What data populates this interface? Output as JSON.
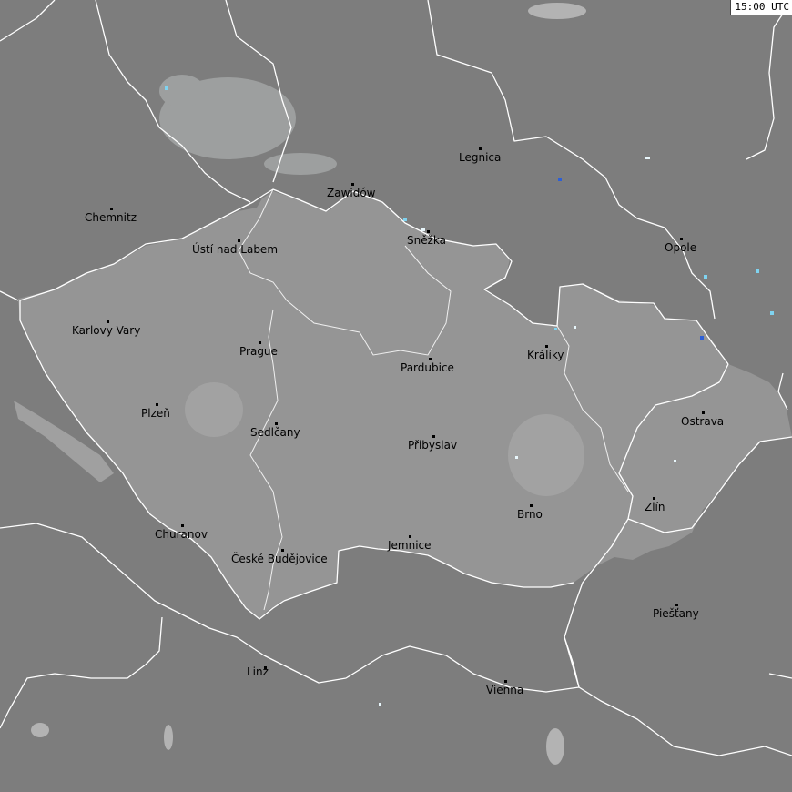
{
  "timestamp": "15:00 UTC",
  "colors": {
    "background": "#7d7d7d",
    "region": "#959595",
    "border": "#ffffff",
    "water": "#b3b3b3",
    "lightning_light": "#9fa1a1",
    "lightning_cyan": "#7fd3f0",
    "lightning_blue": "#2d5fd6"
  },
  "cities": [
    {
      "name": "Legnica"
    },
    {
      "name": "Chemnitz"
    },
    {
      "name": "Zawidów"
    },
    {
      "name": "Ústí nad Labem"
    },
    {
      "name": "Sněžka"
    },
    {
      "name": "Opole"
    },
    {
      "name": "Karlovy Vary"
    },
    {
      "name": "Prague"
    },
    {
      "name": "Králíky"
    },
    {
      "name": "Pardubice"
    },
    {
      "name": "Plzeň"
    },
    {
      "name": "Sedlčany"
    },
    {
      "name": "Přibyslav"
    },
    {
      "name": "Ostrava"
    },
    {
      "name": "Zlín"
    },
    {
      "name": "Brno"
    },
    {
      "name": "Churanov"
    },
    {
      "name": "České Budějovice"
    },
    {
      "name": "Jemnice"
    },
    {
      "name": "Piešťany"
    },
    {
      "name": "Linz"
    },
    {
      "name": "Vienna"
    }
  ]
}
